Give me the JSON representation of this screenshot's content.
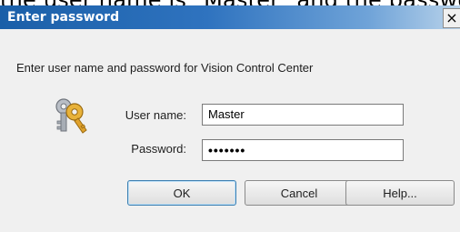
{
  "banner": {
    "text": "the user name is \"Master\" and the passwo"
  },
  "dialog": {
    "title": "Enter password",
    "close_glyph": "×",
    "instruction": "Enter user name and password for Vision Control Center",
    "icon": "keys-icon",
    "username_label": "User name:",
    "username_value": "Master",
    "password_label": "Password:",
    "password_value": "•••••••",
    "ok_label": "OK",
    "cancel_label": "Cancel",
    "help_label": "Help..."
  },
  "colors": {
    "titlebar_start": "#1a5fa8",
    "titlebar_end": "#b8d2ea",
    "dialog_bg": "#f0f0f0",
    "key_gold": "#d8a02a",
    "key_silver": "#9aa0a8"
  }
}
